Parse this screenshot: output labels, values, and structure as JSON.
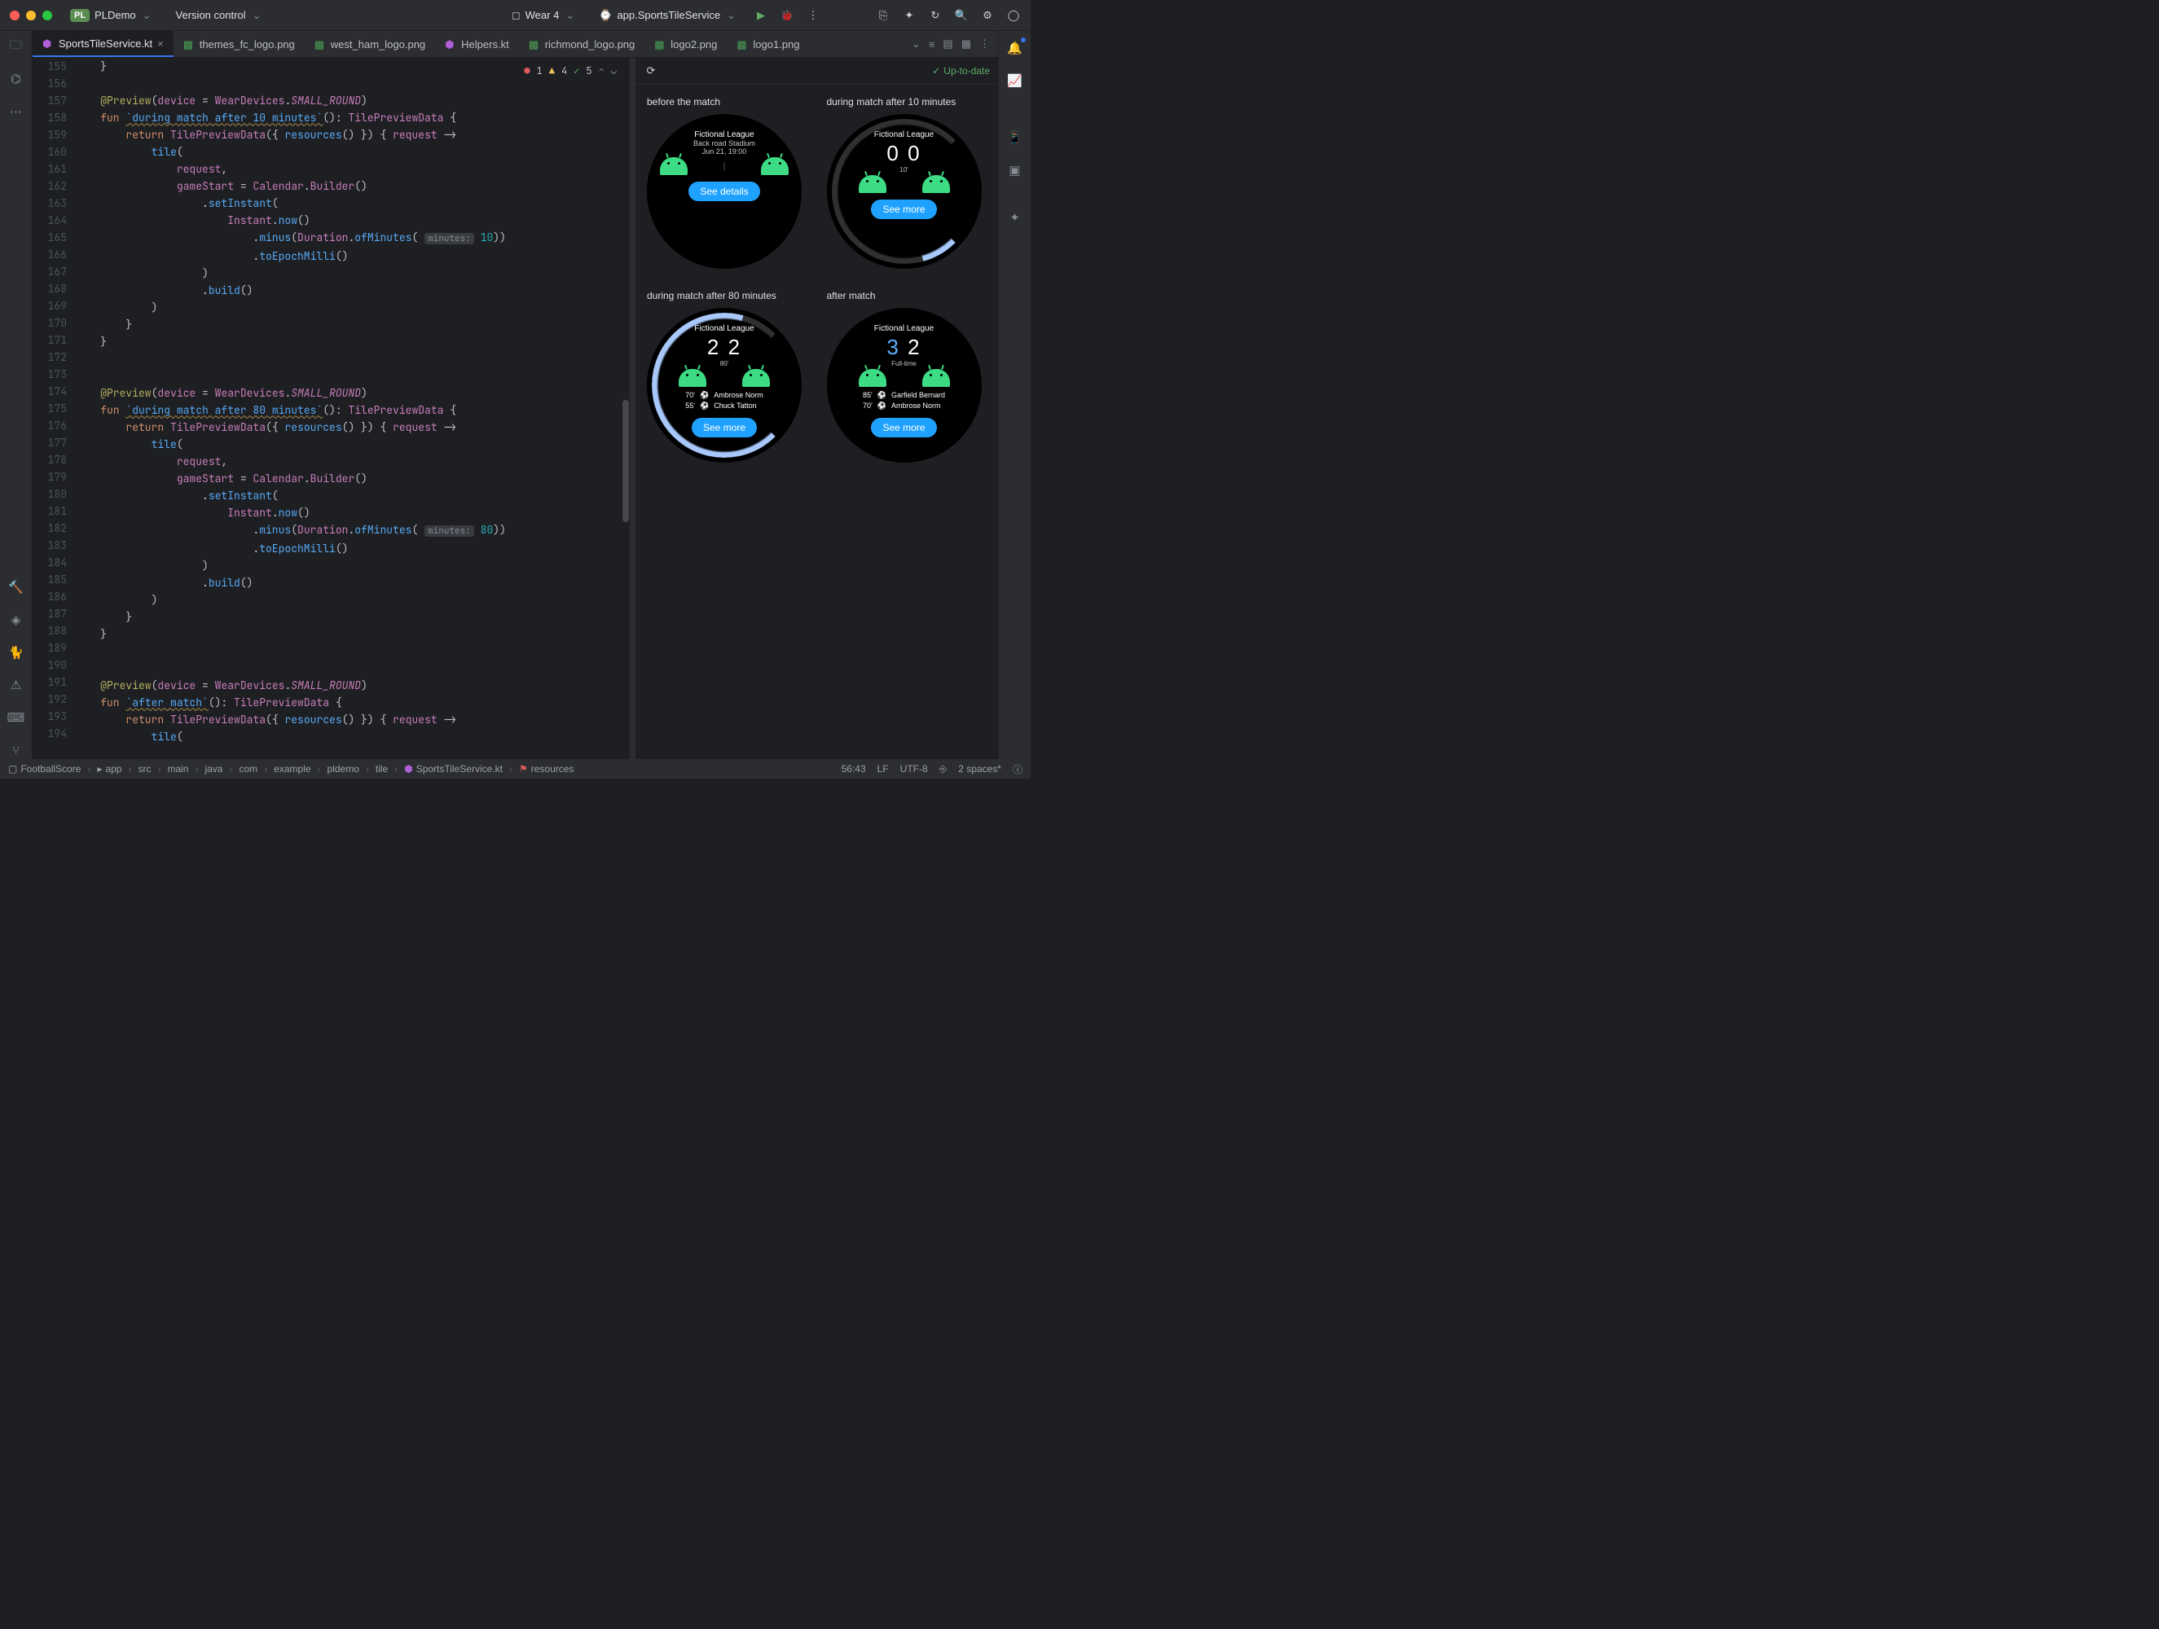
{
  "titlebar": {
    "project_badge": "PL",
    "project_name": "PLDemo",
    "vcs": "Version control",
    "device": "Wear 4",
    "run_config": "app.SportsTileService"
  },
  "tabs": [
    {
      "label": "SportsTileService.kt",
      "active": true,
      "kind": "kt"
    },
    {
      "label": "themes_fc_logo.png",
      "kind": "img"
    },
    {
      "label": "west_ham_logo.png",
      "kind": "img"
    },
    {
      "label": "Helpers.kt",
      "kind": "kt"
    },
    {
      "label": "richmond_logo.png",
      "kind": "img"
    },
    {
      "label": "logo2.png",
      "kind": "img"
    },
    {
      "label": "logo1.png",
      "kind": "img"
    }
  ],
  "inspections": {
    "errors": "1",
    "warnings": "4",
    "ok": "5"
  },
  "gutter_start": 155,
  "gutter_end": 194,
  "code_lines": [
    "    }",
    "",
    "    @Preview(device = WearDevices.SMALL_ROUND)",
    "    fun `during match after 10 minutes`(): TilePreviewData {",
    "        return TilePreviewData({ resources() }) { request ->",
    "            tile(",
    "                request,",
    "                gameStart = Calendar.Builder()",
    "                    .setInstant(",
    "                        Instant.now()",
    "                            .minus(Duration.ofMinutes( minutes: 10))",
    "                            .toEpochMilli()",
    "                    )",
    "                    .build()",
    "            )",
    "        }",
    "    }",
    "",
    "",
    "    @Preview(device = WearDevices.SMALL_ROUND)",
    "    fun `during match after 80 minutes`(): TilePreviewData {",
    "        return TilePreviewData({ resources() }) { request ->",
    "            tile(",
    "                request,",
    "                gameStart = Calendar.Builder()",
    "                    .setInstant(",
    "                        Instant.now()",
    "                            .minus(Duration.ofMinutes( minutes: 80))",
    "                            .toEpochMilli()",
    "                    )",
    "                    .build()",
    "            )",
    "        }",
    "    }",
    "",
    "",
    "    @Preview(device = WearDevices.SMALL_ROUND)",
    "    fun `after match`(): TilePreviewData {",
    "        return TilePreviewData({ resources() }) { request ->",
    "            tile("
  ],
  "preview": {
    "status": "Up-to-date",
    "tiles": [
      {
        "label": "before the match",
        "league": "Fictional League",
        "sub1": "Back road Stadium",
        "sub2": "Jun 21, 19:00",
        "button": "See details",
        "score": "",
        "progress": 0
      },
      {
        "label": "during match after 10 minutes",
        "league": "Fictional League",
        "score": "0 | 0",
        "mins": "10'",
        "button": "See more",
        "progress": 11
      },
      {
        "label": "during match after 80 minutes",
        "league": "Fictional League",
        "score": "2 | 2",
        "mins": "80'",
        "button": "See more",
        "progress": 89,
        "events": [
          {
            "t": "70'",
            "p": "Ambrose Norm"
          },
          {
            "t": "55'",
            "p": "Chuck Tatton"
          }
        ]
      },
      {
        "label": "after match",
        "league": "Fictional League",
        "score": "3 | 2",
        "mins": "Full-time",
        "button": "See more",
        "progress": 0,
        "home_hl": true,
        "events": [
          {
            "t": "85'",
            "p": "Garfield Bernard"
          },
          {
            "t": "70'",
            "p": "Ambrose Norm"
          }
        ]
      }
    ]
  },
  "breadcrumbs": [
    "FootballScore",
    "app",
    "src",
    "main",
    "java",
    "com",
    "example",
    "pldemo",
    "tile",
    "SportsTileService.kt",
    "resources"
  ],
  "status": {
    "pos": "56:43",
    "le": "LF",
    "enc": "UTF-8",
    "indent": "2 spaces*"
  }
}
